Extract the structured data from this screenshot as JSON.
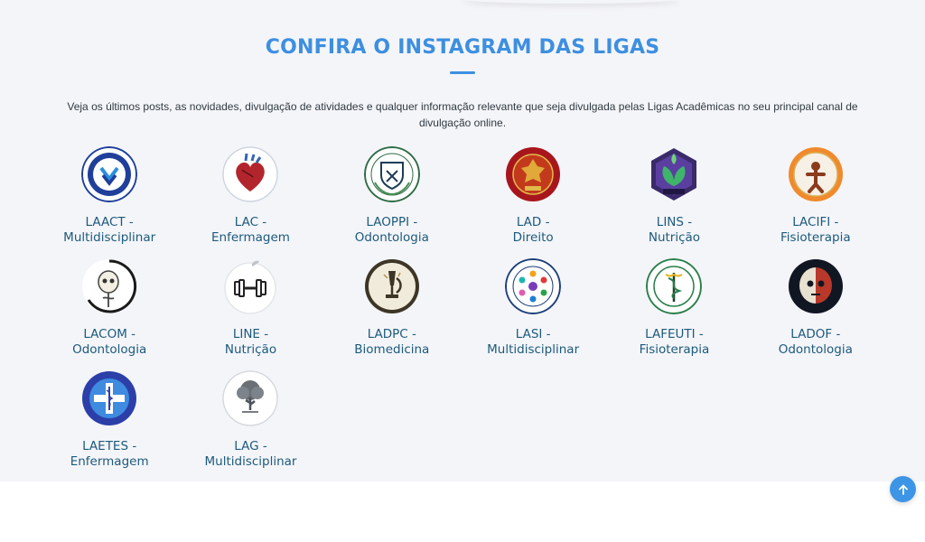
{
  "section": {
    "title": "CONFIRA O INSTAGRAM DAS LIGAS",
    "description": "Veja os últimos posts, as novidades, divulgação de atividades e qualquer informação relevante que seja divulgada pelas Ligas Acadêmicas no seu principal canal de divulgação online."
  },
  "leagues": [
    {
      "name": "LAACT -",
      "area": "Multidisciplinar",
      "icon": "laact-logo-icon"
    },
    {
      "name": "LAC -",
      "area": "Enfermagem",
      "icon": "lac-heart-logo-icon"
    },
    {
      "name": "LAOPPI -",
      "area": "Odontologia",
      "icon": "laoppi-logo-icon"
    },
    {
      "name": "LAD -",
      "area": "Direito",
      "icon": "lad-logo-icon"
    },
    {
      "name": "LINS -",
      "area": "Nutrição",
      "icon": "lins-leaf-logo-icon"
    },
    {
      "name": "LACIFI -",
      "area": "Fisioterapia",
      "icon": "lacifi-logo-icon"
    },
    {
      "name": "LACOM -",
      "area": "Odontologia",
      "icon": "lacom-skull-logo-icon"
    },
    {
      "name": "LINE -",
      "area": "Nutrição",
      "icon": "line-dumbbell-logo-icon"
    },
    {
      "name": "LADPC -",
      "area": "Biomedicina",
      "icon": "ladpc-microscope-logo-icon"
    },
    {
      "name": "LASI -",
      "area": "Multidisciplinar",
      "icon": "lasi-logo-icon"
    },
    {
      "name": "LAFEUTI -",
      "area": "Fisioterapia",
      "icon": "lafeuti-logo-icon"
    },
    {
      "name": "LADOF -",
      "area": "Odontologia",
      "icon": "ladof-skull-logo-icon"
    },
    {
      "name": "LAETES -",
      "area": "Enfermagem",
      "icon": "laetes-logo-icon"
    },
    {
      "name": "LAG -",
      "area": "Multidisciplinar",
      "icon": "lag-tree-logo-icon"
    }
  ],
  "colors": {
    "accent": "#3d8fe0",
    "label": "#1c5a7c",
    "section_bg": "#f4f5f9"
  },
  "scroll_top": {
    "icon": "arrow-up-icon"
  }
}
